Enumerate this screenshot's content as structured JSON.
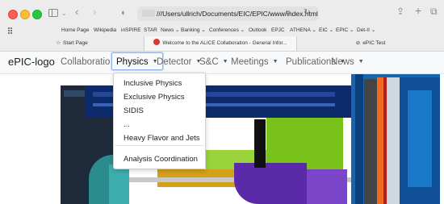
{
  "browser": {
    "url": "///Users/ullrich/Documents/EIC/EPIC/www/index.html",
    "favorites": [
      "Home Page",
      "Wikipedia",
      "inSPIRE",
      "STAR",
      "News ⌄",
      "Banking ⌄",
      "Conferences ⌄",
      "Outlook",
      "EPJC",
      "ATHENA ⌄",
      "EIC ⌄",
      "EPIC ⌄",
      "Det-II ⌄"
    ],
    "tabs": [
      {
        "label": "Start Page",
        "icon": "star-icon"
      },
      {
        "label": "Welcome to the ALICE Collaboration - General Infor...",
        "icon": "alice-favicon"
      },
      {
        "label": "ePIC Test",
        "icon": "compass-icon"
      }
    ],
    "active_tab_index": 1
  },
  "site": {
    "brand": "ePIC-logo",
    "nav": [
      {
        "label": "Collaboration"
      },
      {
        "label": "Physics"
      },
      {
        "label": "Detector"
      },
      {
        "label": "S&C"
      },
      {
        "label": "Meetings"
      },
      {
        "label": "Publications"
      },
      {
        "label": "News"
      }
    ],
    "active_nav": "Physics"
  },
  "dropdown": {
    "items": [
      "Inclusive Physics",
      "Exclusive Physics",
      "SIDIS",
      "...",
      "Heavy Flavor and Jets"
    ],
    "footer_item": "Analysis Coordination"
  },
  "colors": {
    "accent_focus": "#8db3f0",
    "detector_navy": "#0d2a6b",
    "detector_blue": "#1565b0",
    "detector_green": "#79c21a",
    "detector_purple": "#5a2aa8",
    "detector_orange": "#f26a21",
    "detector_teal": "#2a8c8c",
    "detector_gold": "#d4a017"
  }
}
